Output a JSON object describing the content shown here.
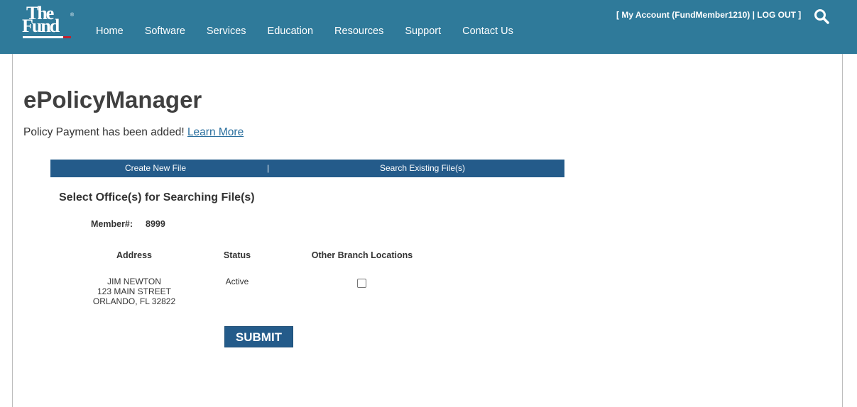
{
  "logo": {
    "line1": "The",
    "line2": "Fund",
    "mark": "®"
  },
  "nav": {
    "items": [
      {
        "label": "Home"
      },
      {
        "label": "Software"
      },
      {
        "label": "Services"
      },
      {
        "label": "Education"
      },
      {
        "label": "Resources"
      },
      {
        "label": "Support"
      },
      {
        "label": "Contact Us"
      }
    ]
  },
  "account": {
    "open": "[ ",
    "my_account": "My Account (FundMember1210)",
    "sep": " | ",
    "logout": "LOG OUT",
    "close": " ]"
  },
  "search": {
    "icon": "search-icon"
  },
  "page": {
    "title": "ePolicyManager",
    "notice_text": "Policy Payment has been added! ",
    "notice_link": "Learn More"
  },
  "tabs": {
    "create": "Create New File",
    "separator": "|",
    "search": "Search Existing File(s)"
  },
  "section": {
    "title": "Select Office(s) for Searching File(s)",
    "member_label": "Member#:",
    "member_value": "8999"
  },
  "table": {
    "headers": {
      "address": "Address",
      "status": "Status",
      "other": "Other Branch Locations"
    },
    "rows": [
      {
        "address": [
          "JIM NEWTON",
          "123 MAIN STREET",
          "ORLANDO, FL 32822"
        ],
        "status": "Active",
        "other_checked": false
      }
    ]
  },
  "submit_label": "SUBMIT",
  "colors": {
    "header": "#2f7a9a",
    "accent": "#245b8a",
    "link": "#2a6f9e"
  }
}
